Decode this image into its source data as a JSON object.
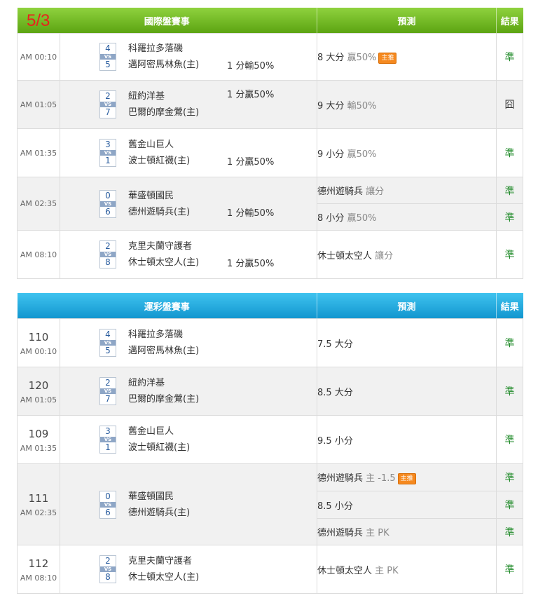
{
  "date": "5/3",
  "colors": {
    "green_header": "#6db31f",
    "blue_header": "#1aa5dc",
    "win": "#1f8a28",
    "tag": "#f5891f"
  },
  "sections": [
    {
      "header": {
        "title": "國際盤賽事",
        "predict": "預測",
        "result": "結果"
      },
      "matches": [
        {
          "time": "AM 00:10",
          "score_away": "4",
          "score_home": "5",
          "away": "科羅拉多落磯",
          "home": "邁阿密馬林魚(主)",
          "handicap": {
            "pos": "bottom",
            "text": "1 分輸50%"
          },
          "rows": [
            {
              "pred_main": "8 大分",
              "pred_extra": "贏50%",
              "tag": "主推",
              "result": "準"
            }
          ]
        },
        {
          "time": "AM 01:05",
          "score_away": "2",
          "score_home": "7",
          "away": "紐約洋基",
          "home": "巴爾的摩金鶯(主)",
          "handicap": {
            "pos": "top",
            "text": "1 分贏50%"
          },
          "rows": [
            {
              "pred_main": "9 大分",
              "pred_extra": "輸50%",
              "tag": "",
              "result": "囧"
            }
          ]
        },
        {
          "time": "AM 01:35",
          "score_away": "3",
          "score_home": "1",
          "away": "舊金山巨人",
          "home": "波士頓紅襪(主)",
          "handicap": {
            "pos": "bottom",
            "text": "1 分贏50%"
          },
          "rows": [
            {
              "pred_main": "9 小分",
              "pred_extra": "贏50%",
              "tag": "",
              "result": "準"
            }
          ]
        },
        {
          "time": "AM 02:35",
          "score_away": "0",
          "score_home": "6",
          "away": "華盛頓國民",
          "home": "德州遊騎兵(主)",
          "handicap": {
            "pos": "bottom",
            "text": "1 分輸50%"
          },
          "rows": [
            {
              "pred_main": "德州遊騎兵",
              "pred_extra": "讓分",
              "tag": "",
              "result": "準"
            },
            {
              "pred_main": "8 小分",
              "pred_extra": "贏50%",
              "tag": "",
              "result": "準"
            }
          ]
        },
        {
          "time": "AM 08:10",
          "score_away": "2",
          "score_home": "8",
          "away": "克里夫蘭守護者",
          "home": "休士頓太空人(主)",
          "handicap": {
            "pos": "bottom",
            "text": "1 分贏50%"
          },
          "rows": [
            {
              "pred_main": "休士頓太空人",
              "pred_extra": "讓分",
              "tag": "",
              "result": "準"
            }
          ]
        }
      ]
    },
    {
      "header": {
        "title": "運彩盤賽事",
        "predict": "預測",
        "result": "結果"
      },
      "matches": [
        {
          "num": "110",
          "time": "AM 00:10",
          "score_away": "4",
          "score_home": "5",
          "away": "科羅拉多落磯",
          "home": "邁阿密馬林魚(主)",
          "rows": [
            {
              "pred_main": "7.5 大分",
              "pred_extra": "",
              "tag": "",
              "result": "準"
            }
          ]
        },
        {
          "num": "120",
          "time": "AM 01:05",
          "score_away": "2",
          "score_home": "7",
          "away": "紐約洋基",
          "home": "巴爾的摩金鶯(主)",
          "rows": [
            {
              "pred_main": "8.5 大分",
              "pred_extra": "",
              "tag": "",
              "result": "準"
            }
          ]
        },
        {
          "num": "109",
          "time": "AM 01:35",
          "score_away": "3",
          "score_home": "1",
          "away": "舊金山巨人",
          "home": "波士頓紅襪(主)",
          "rows": [
            {
              "pred_main": "9.5 小分",
              "pred_extra": "",
              "tag": "",
              "result": "準"
            }
          ]
        },
        {
          "num": "111",
          "time": "AM 02:35",
          "score_away": "0",
          "score_home": "6",
          "away": "華盛頓國民",
          "home": "德州遊騎兵(主)",
          "rows": [
            {
              "pred_main": "德州遊騎兵",
              "pred_extra": "主 -1.5",
              "tag": "主推",
              "result": "準"
            },
            {
              "pred_main": "8.5 小分",
              "pred_extra": "",
              "tag": "",
              "result": "準"
            },
            {
              "pred_main": "德州遊騎兵",
              "pred_extra": "主 PK",
              "tag": "",
              "result": "準"
            }
          ]
        },
        {
          "num": "112",
          "time": "AM 08:10",
          "score_away": "2",
          "score_home": "8",
          "away": "克里夫蘭守護者",
          "home": "休士頓太空人(主)",
          "rows": [
            {
              "pred_main": "休士頓太空人",
              "pred_extra": "主 PK",
              "tag": "",
              "result": "準"
            }
          ]
        }
      ]
    }
  ]
}
